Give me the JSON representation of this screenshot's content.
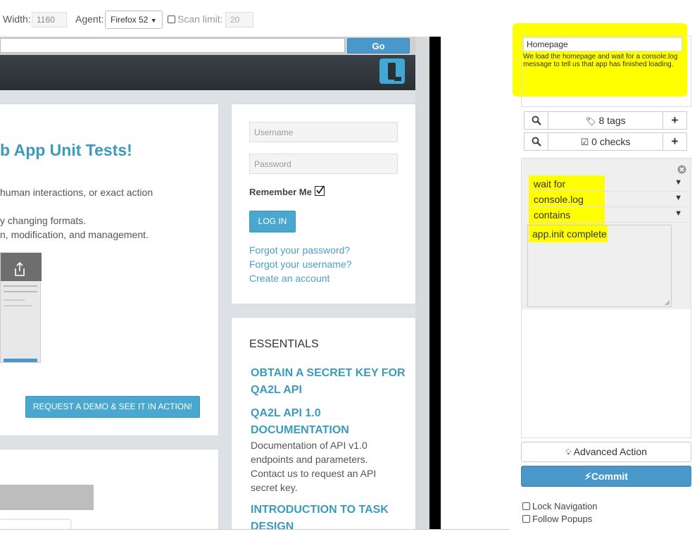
{
  "toolbar": {
    "width_label": "Width:",
    "width_value": "1160",
    "agent_label": "Agent:",
    "agent_value": "Firefox 52",
    "scan_label": "Scan limit:",
    "scan_value": "20"
  },
  "preview": {
    "go_label": "Go",
    "main_heading": "b App Unit Tests!",
    "body_lines": [
      "human interactions, or exact action",
      "y changing formats.",
      "n, modification, and management."
    ],
    "demo_button": "REQUEST A DEMO & SEE IT IN ACTION!",
    "login": {
      "username_placeholder": "Username",
      "password_placeholder": "Password",
      "remember_label": "Remember Me",
      "login_button": "LOG IN",
      "forgot_password": "Forgot your password?",
      "forgot_username": "Forgot your username?",
      "create_account": "Create an account"
    },
    "essentials": {
      "title": "ESSENTIALS",
      "link1": "OBTAIN A SECRET KEY FOR QA2L API",
      "link2": "QA2L API 1.0 DOCUMENTATION",
      "doc_text": "Documentation of API v1.0 endpoints and parameters. Contact us to request an API secret key.",
      "link3": "INTRODUCTION TO TASK DESIGN"
    }
  },
  "panel": {
    "step_name": "Homepage",
    "step_desc": "We load the homepage and wait for a console.log message to tell us that app has finished loading.",
    "tags_label": "8 tags",
    "checks_label": "0 checks",
    "action_type": "wait for",
    "action_target": "console.log",
    "action_operator": "contains",
    "action_value": "app.init complete",
    "advanced_label": "Advanced Action",
    "commit_label": "Commit",
    "lock_nav_label": "Lock Navigation",
    "follow_popups_label": "Follow Popups"
  },
  "colors": {
    "accent": "#3b9bbd",
    "commit": "#4a98c9",
    "highlight": "#ffff00"
  }
}
